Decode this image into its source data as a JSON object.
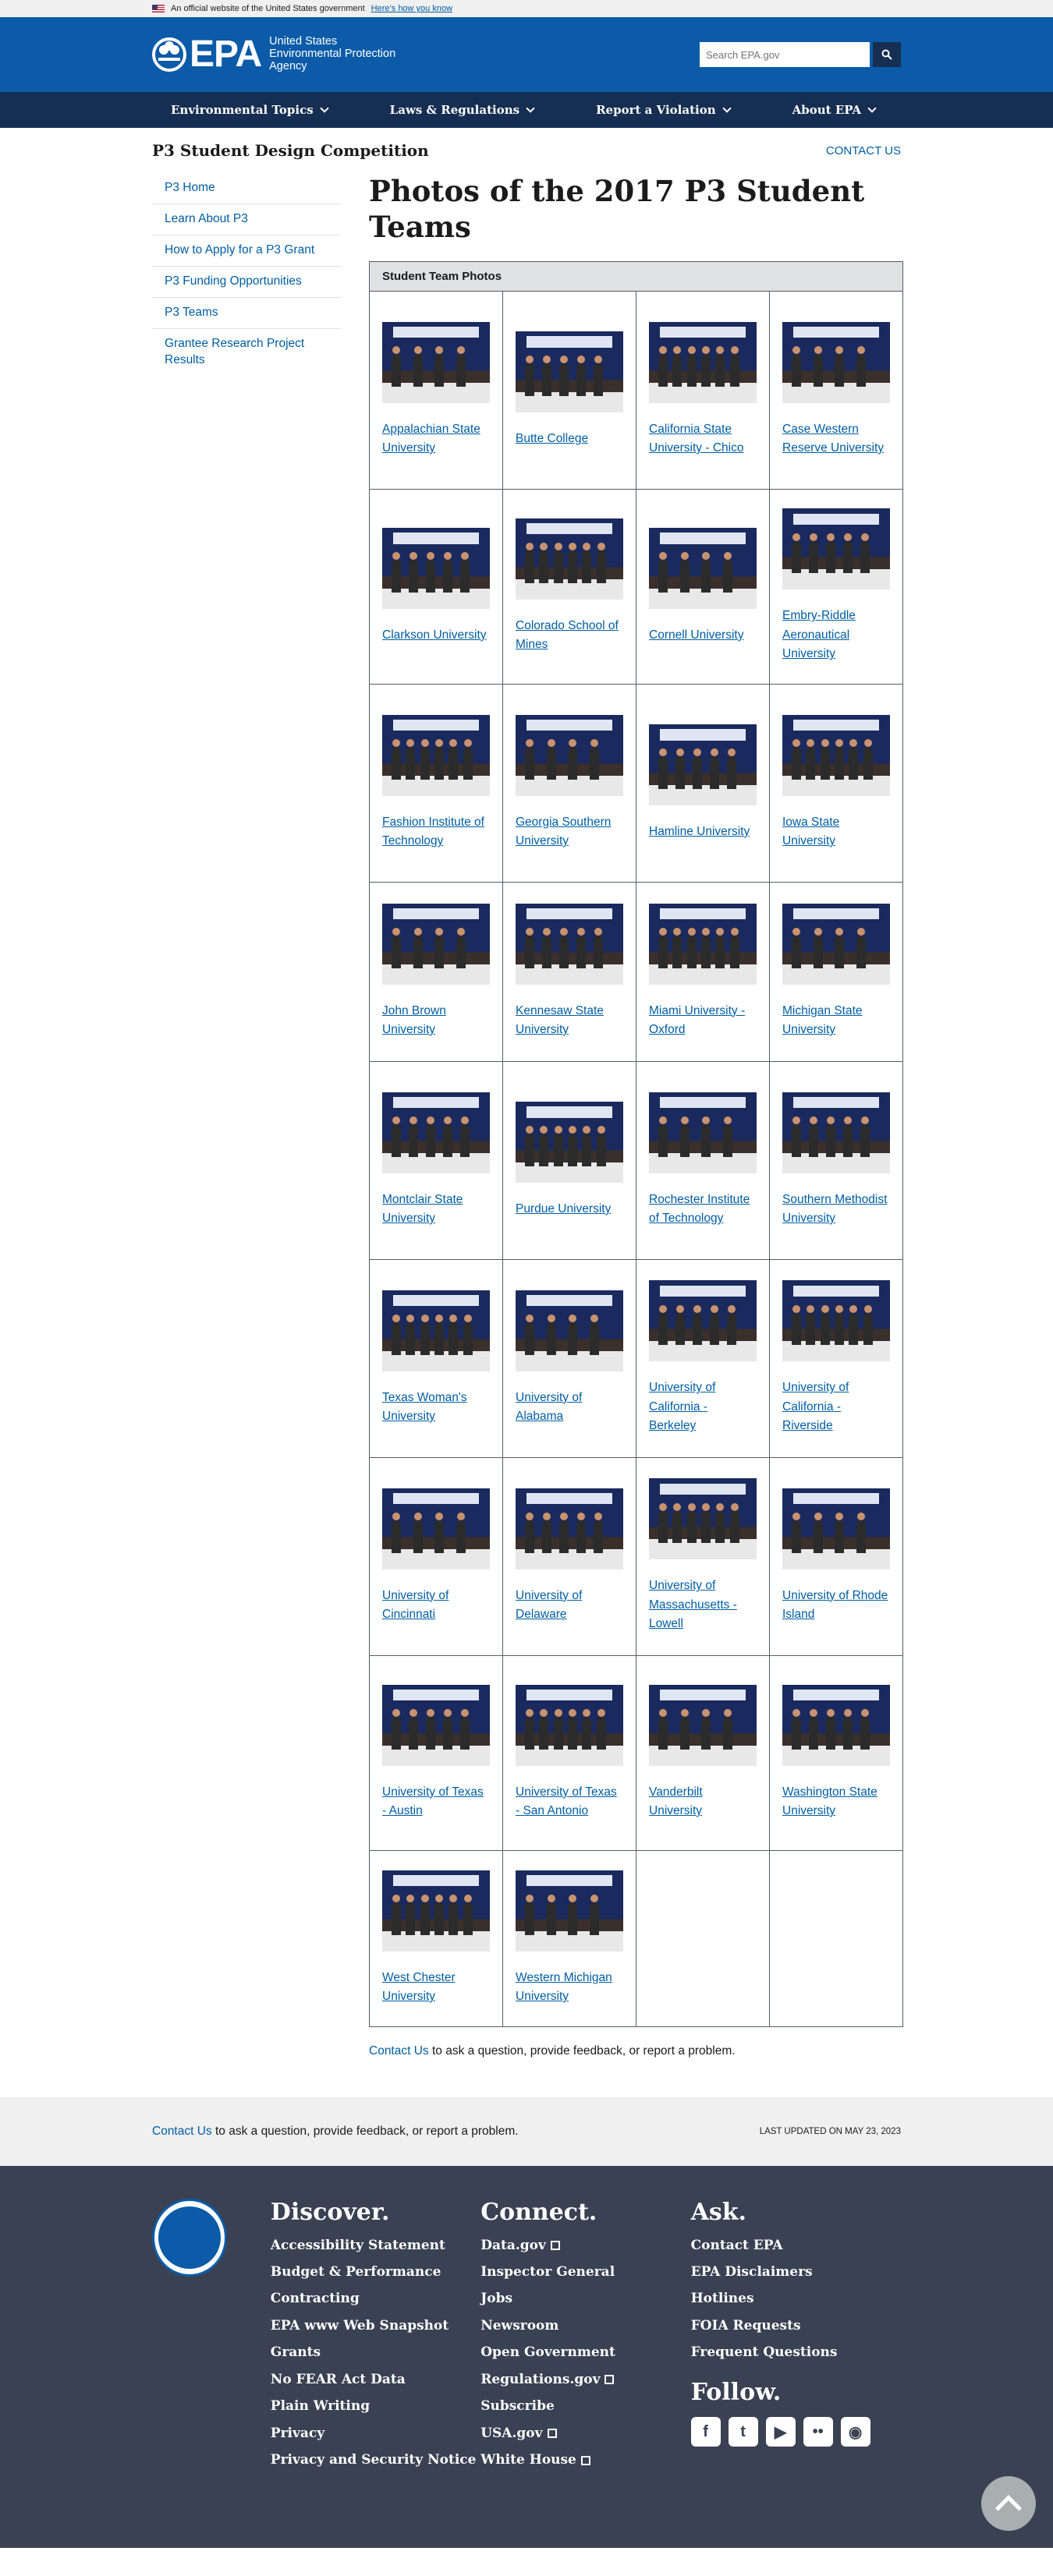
{
  "banner": {
    "text": "An official website of the United States government",
    "link": "Here’s how you know"
  },
  "header": {
    "logo_word": "EPA",
    "agency_line1": "United States",
    "agency_line2": "Environmental Protection",
    "agency_line3": "Agency",
    "search_placeholder": "Search EPA.gov"
  },
  "nav": {
    "items": [
      "Environmental Topics",
      "Laws & Regulations",
      "Report a Violation",
      "About EPA"
    ]
  },
  "subhead": {
    "site_title": "P3 Student Design Competition",
    "contact": "CONTACT US"
  },
  "sidenav": {
    "items": [
      "P3 Home",
      "Learn About P3",
      "How to Apply for a P3 Grant",
      "P3 Funding Opportunities",
      "P3 Teams",
      "Grantee Research Project Results"
    ]
  },
  "main": {
    "title": "Photos of the 2017 P3 Student Teams",
    "table_header": "Student Team Photos",
    "teams": [
      "Appalachian State University",
      "Butte College",
      "California State University - Chico",
      "Case Western Reserve University",
      "Clarkson University",
      "Colorado School of Mines",
      "Cornell University",
      "Embry-Riddle Aeronautical University",
      "Fashion Institute of Technology",
      "Georgia Southern University",
      "Hamline University",
      "Iowa State University",
      "John Brown University",
      "Kennesaw State University",
      "Miami University - Oxford",
      "Michigan State University",
      "Montclair State University",
      "Purdue University",
      "Rochester Institute of Technology",
      "Southern Methodist University",
      "Texas Woman's University",
      "University of Alabama",
      "University of California - Berkeley",
      "University of California - Riverside",
      "University of Cincinnati",
      "University of Delaware",
      "University of Massachusetts - Lowell",
      "University of Rhode Island",
      "University of Texas - Austin",
      "University of Texas - San Antonio",
      "Vanderbilt University",
      "Washington State University",
      "West Chester University",
      "Western Michigan University"
    ],
    "after_link": "Contact Us",
    "after_text": " to ask a question, provide feedback, or report a problem."
  },
  "feedback": {
    "link": "Contact Us",
    "text": " to ask a question, provide feedback, or report a problem.",
    "updated": "LAST UPDATED ON MAY 23, 2023"
  },
  "footer": {
    "discover": {
      "heading": "Discover.",
      "links": [
        "Accessibility Statement",
        "Budget & Performance",
        "Contracting",
        "EPA www Web Snapshot",
        "Grants",
        "No FEAR Act Data",
        "Plain Writing",
        "Privacy",
        "Privacy and Security Notice"
      ]
    },
    "connect": {
      "heading": "Connect.",
      "links": [
        "Data.gov",
        "Inspector General",
        "Jobs",
        "Newsroom",
        "Open Government",
        "Regulations.gov",
        "Subscribe",
        "USA.gov",
        "White House"
      ]
    },
    "ask": {
      "heading": "Ask.",
      "links": [
        "Contact EPA",
        "EPA Disclaimers",
        "Hotlines",
        "FOIA Requests",
        "Frequent Questions"
      ]
    },
    "follow": {
      "heading": "Follow."
    }
  }
}
